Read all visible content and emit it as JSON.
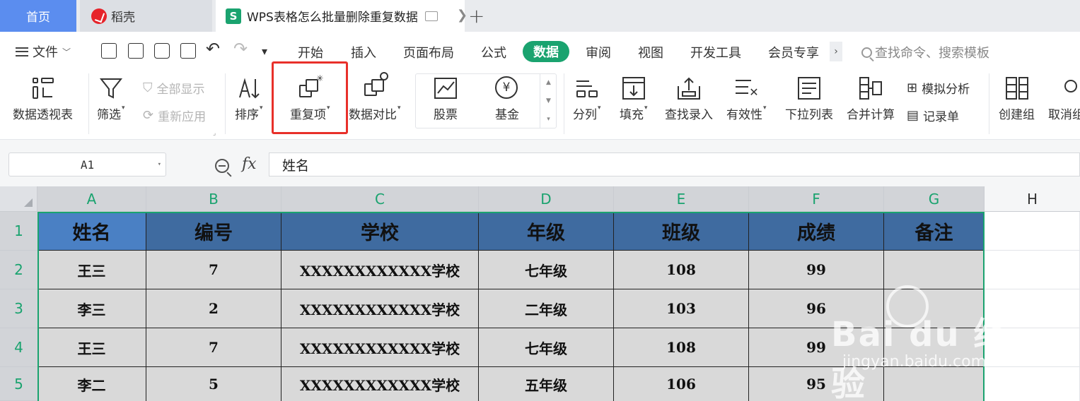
{
  "tabs": {
    "home": "首页",
    "daoke": "稻壳",
    "active": "WPS表格怎么批量删除重复数据",
    "add": "+"
  },
  "menu": {
    "file": "文件",
    "items": [
      "开始",
      "插入",
      "页面布局",
      "公式",
      "数据",
      "审阅",
      "视图",
      "开发工具",
      "会员专享"
    ],
    "active_index": 4,
    "search_placeholder": "查找命令、搜索模板"
  },
  "ribbon": {
    "pivot": "数据透视表",
    "filter": "筛选",
    "show_all": "全部显示",
    "reapply": "重新应用",
    "sort": "排序",
    "duplicates": "重复项",
    "compare": "数据对比",
    "stock": "股票",
    "fund": "基金",
    "split": "分列",
    "fill": "填充",
    "find_entry": "查找录入",
    "validity": "有效性",
    "dropdown": "下拉列表",
    "consolidate": "合并计算",
    "simulate": "模拟分析",
    "record": "记录单",
    "group": "创建组",
    "ungroup": "取消组"
  },
  "formula_bar": {
    "name_box": "A1",
    "fx": "fx",
    "value": "姓名"
  },
  "sheet": {
    "columns": [
      "A",
      "B",
      "C",
      "D",
      "E",
      "F",
      "G",
      "H"
    ],
    "rows": [
      "1",
      "2",
      "3",
      "4",
      "5"
    ],
    "header": [
      "姓名",
      "编号",
      "学校",
      "年级",
      "班级",
      "成绩",
      "备注"
    ],
    "data": [
      [
        "王三",
        "7",
        "XXXXXXXXXXXX学校",
        "七年级",
        "108",
        "99",
        ""
      ],
      [
        "李三",
        "2",
        "XXXXXXXXXXXX学校",
        "二年级",
        "103",
        "96",
        ""
      ],
      [
        "王三",
        "7",
        "XXXXXXXXXXXX学校",
        "七年级",
        "108",
        "99",
        ""
      ],
      [
        "李二",
        "5",
        "XXXXXXXXXXXX学校",
        "五年级",
        "106",
        "95",
        ""
      ]
    ]
  },
  "watermark": {
    "brand": "Bai du 经验",
    "url": "jingyan.baidu.com"
  },
  "colors": {
    "accent_green": "#1aa36f",
    "header_fill": "#3f6ba0",
    "highlight_red": "#e8302a"
  }
}
